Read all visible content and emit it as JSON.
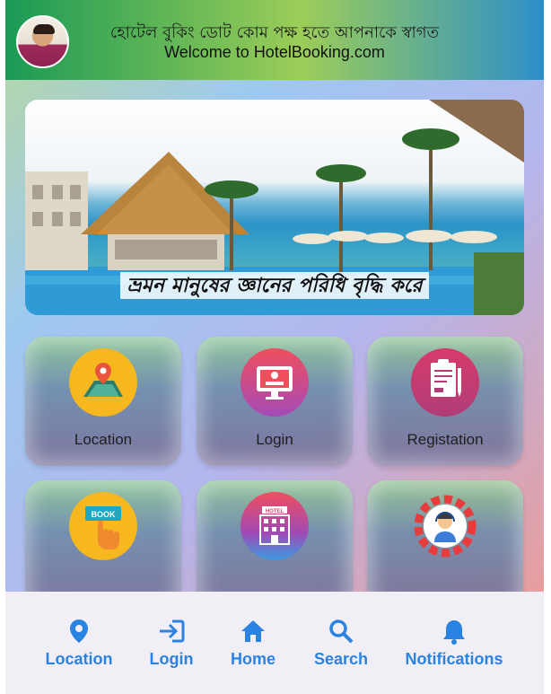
{
  "header": {
    "title_bn": "হোটেল বুকিং ডোট কোম পক্ষ  হতে আপনাকে স্বাগত",
    "subtitle": "Welcome to HotelBooking.com"
  },
  "banner": {
    "caption": "ভ্রমন মানুষের জ্ঞানের পরিধি বৃদ্ধি করে"
  },
  "cards": [
    {
      "label": "Location",
      "icon": "location-map-icon"
    },
    {
      "label": "Login",
      "icon": "login-monitor-icon"
    },
    {
      "label": "Registation",
      "icon": "registration-clipboard-icon"
    },
    {
      "label": "",
      "icon": "book-button-icon"
    },
    {
      "label": "",
      "icon": "hotel-building-icon"
    },
    {
      "label": "",
      "icon": "support-agent-gear-icon"
    }
  ],
  "bottom_nav": [
    {
      "label": "Location",
      "icon": "location-pin-icon"
    },
    {
      "label": "Login",
      "icon": "login-arrow-icon"
    },
    {
      "label": "Home",
      "icon": "home-icon"
    },
    {
      "label": "Search",
      "icon": "search-icon"
    },
    {
      "label": "Notifications",
      "icon": "bell-icon"
    }
  ],
  "colors": {
    "accent": "#2a83e0",
    "header_start": "#1a9a55",
    "header_end": "#2d8fc9"
  }
}
